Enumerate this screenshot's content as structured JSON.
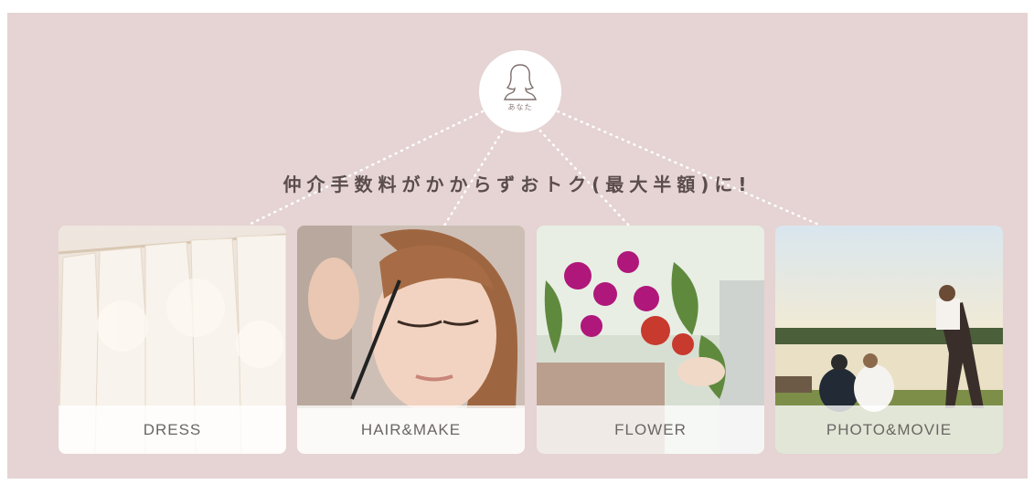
{
  "avatar": {
    "label": "あなた",
    "icon": "person-icon"
  },
  "headline": "仲介手数料がかからずおトク(最大半額)に!",
  "cards": [
    {
      "label": "DRESS",
      "image": "dress-photo"
    },
    {
      "label": "HAIR&MAKE",
      "image": "hair-makeup-photo"
    },
    {
      "label": "FLOWER",
      "image": "flower-photo"
    },
    {
      "label": "PHOTO&MOVIE",
      "image": "photo-movie-photo"
    }
  ],
  "colors": {
    "panel": "#e5d4d3",
    "text": "#5a4d4b",
    "caption": "#6b6664"
  }
}
